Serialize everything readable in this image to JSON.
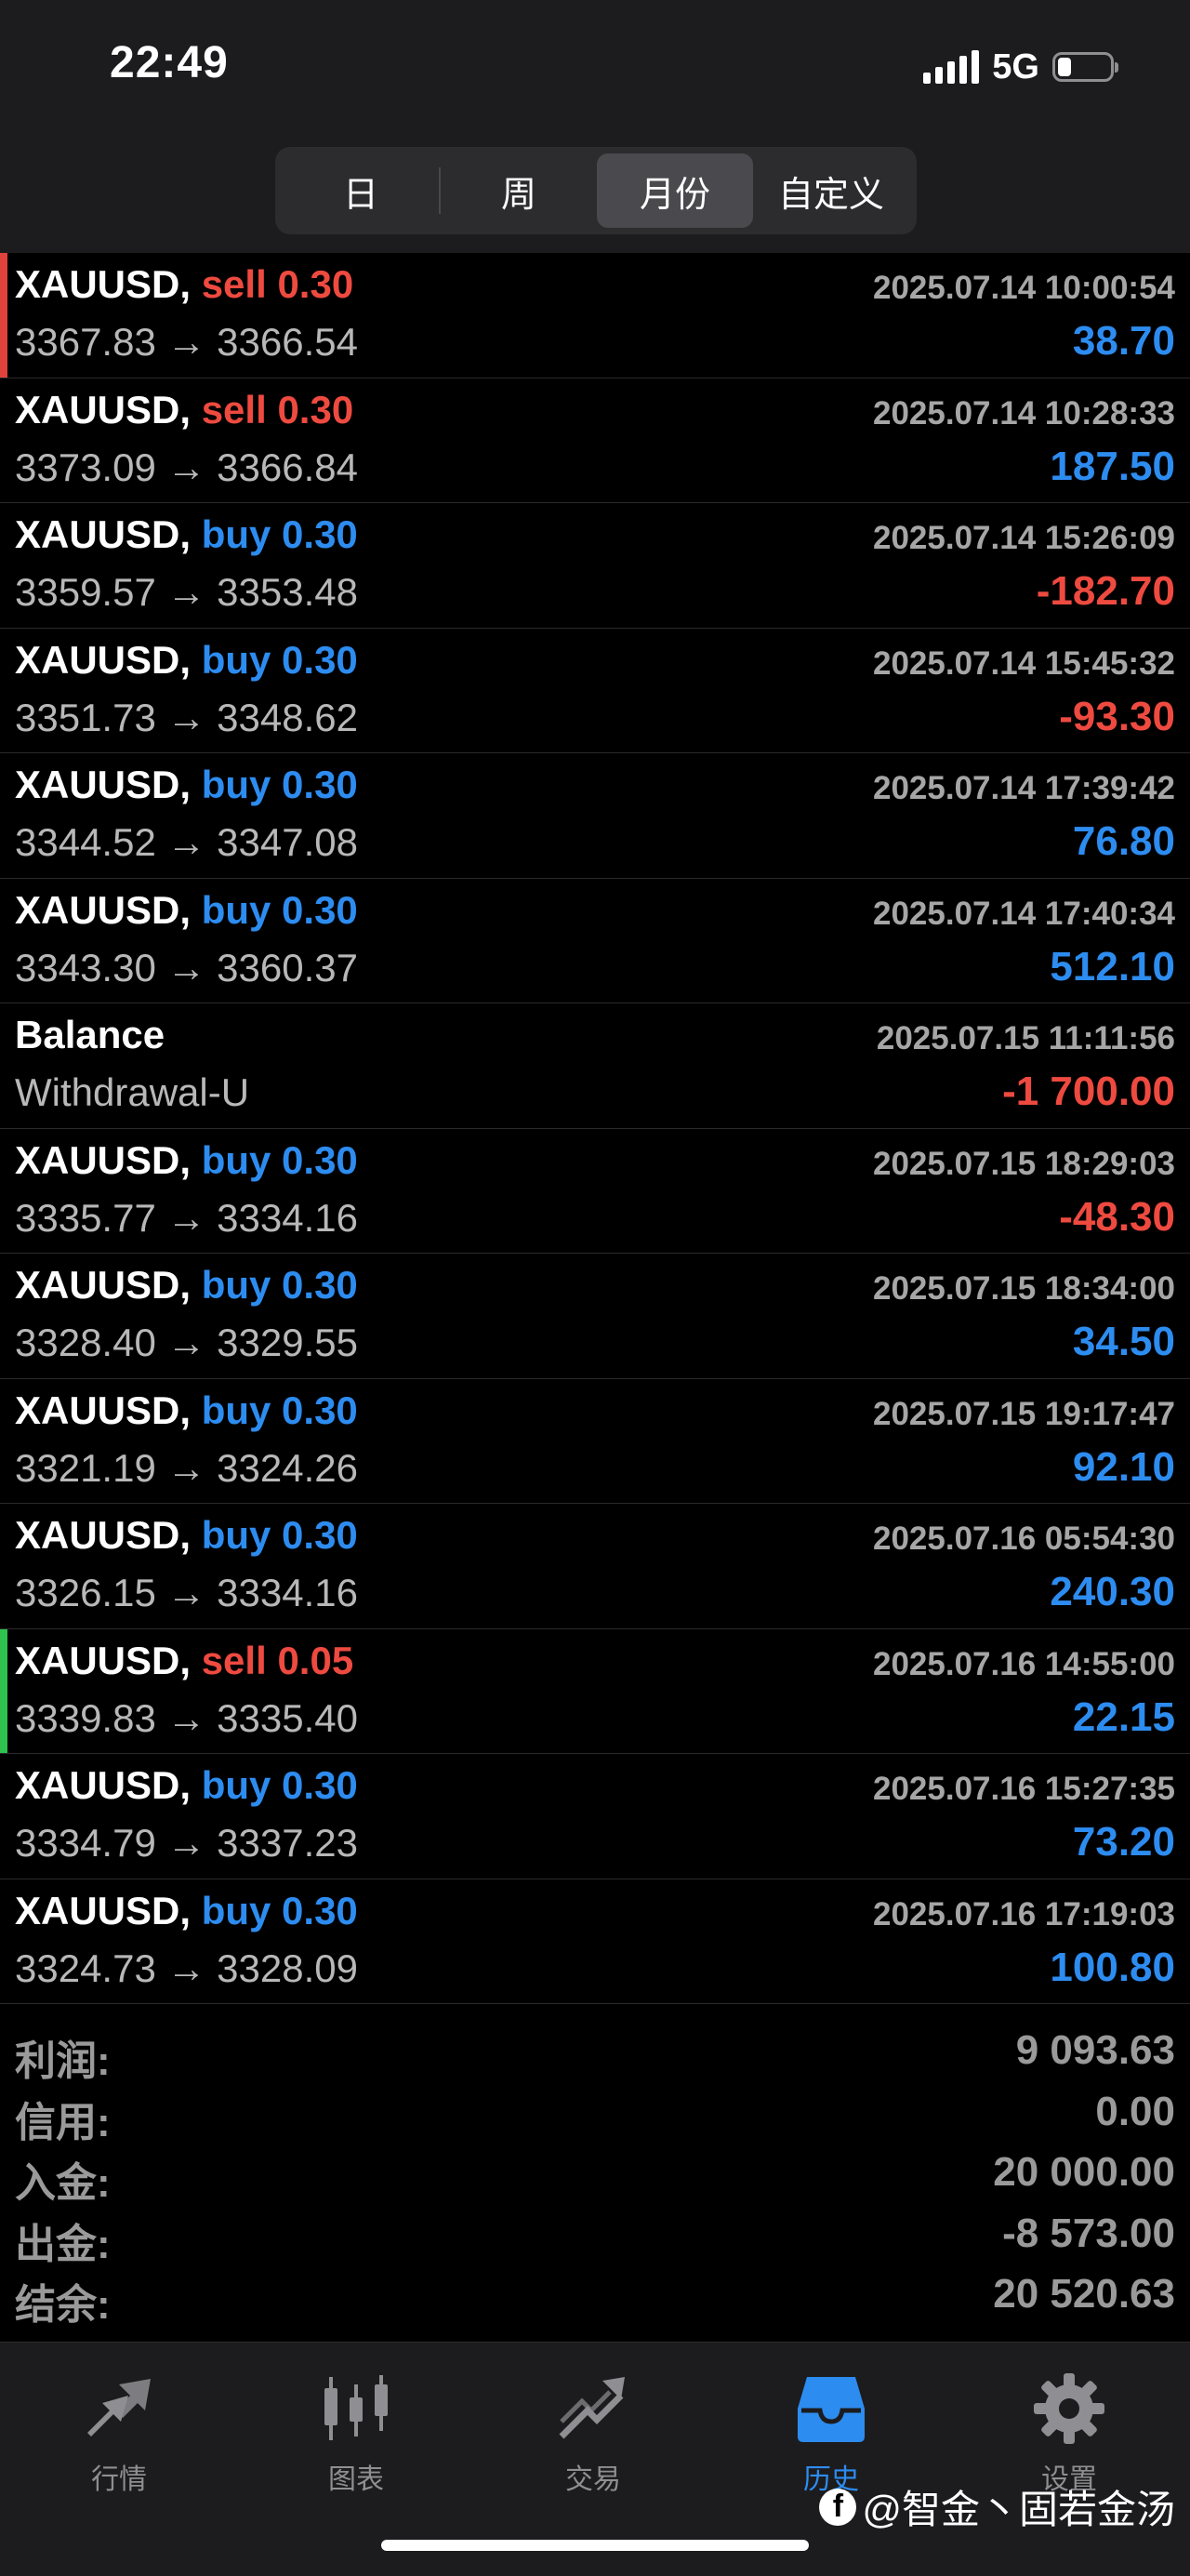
{
  "status_bar": {
    "time": "22:49",
    "network": "5G",
    "battery_level": 0.25
  },
  "period_tabs": [
    {
      "label": "日",
      "active": false
    },
    {
      "label": "周",
      "active": false
    },
    {
      "label": "月份",
      "active": true
    },
    {
      "label": "自定义",
      "active": false
    }
  ],
  "deals": [
    {
      "symbol": "XAUUSD,",
      "side": "sell",
      "volume": "0.30",
      "timestamp": "2025.07.14 10:00:54",
      "prices": "3367.83 → 3366.54",
      "profit": "38.70",
      "marker": "red"
    },
    {
      "symbol": "XAUUSD,",
      "side": "sell",
      "volume": "0.30",
      "timestamp": "2025.07.14 10:28:33",
      "prices": "3373.09 → 3366.84",
      "profit": "187.50"
    },
    {
      "symbol": "XAUUSD,",
      "side": "buy",
      "volume": "0.30",
      "timestamp": "2025.07.14 15:26:09",
      "prices": "3359.57 → 3353.48",
      "profit": "-182.70"
    },
    {
      "symbol": "XAUUSD,",
      "side": "buy",
      "volume": "0.30",
      "timestamp": "2025.07.14 15:45:32",
      "prices": "3351.73 → 3348.62",
      "profit": "-93.30"
    },
    {
      "symbol": "XAUUSD,",
      "side": "buy",
      "volume": "0.30",
      "timestamp": "2025.07.14 17:39:42",
      "prices": "3344.52 → 3347.08",
      "profit": "76.80"
    },
    {
      "symbol": "XAUUSD,",
      "side": "buy",
      "volume": "0.30",
      "timestamp": "2025.07.14 17:40:34",
      "prices": "3343.30 → 3360.37",
      "profit": "512.10"
    },
    {
      "symbol": "Balance",
      "side": "",
      "volume": "",
      "timestamp": "2025.07.15 11:11:56",
      "prices": "Withdrawal-U",
      "profit": "-1 700.00"
    },
    {
      "symbol": "XAUUSD,",
      "side": "buy",
      "volume": "0.30",
      "timestamp": "2025.07.15 18:29:03",
      "prices": "3335.77 → 3334.16",
      "profit": "-48.30"
    },
    {
      "symbol": "XAUUSD,",
      "side": "buy",
      "volume": "0.30",
      "timestamp": "2025.07.15 18:34:00",
      "prices": "3328.40 → 3329.55",
      "profit": "34.50"
    },
    {
      "symbol": "XAUUSD,",
      "side": "buy",
      "volume": "0.30",
      "timestamp": "2025.07.15 19:17:47",
      "prices": "3321.19 → 3324.26",
      "profit": "92.10"
    },
    {
      "symbol": "XAUUSD,",
      "side": "buy",
      "volume": "0.30",
      "timestamp": "2025.07.16 05:54:30",
      "prices": "3326.15 → 3334.16",
      "profit": "240.30"
    },
    {
      "symbol": "XAUUSD,",
      "side": "sell",
      "volume": "0.05",
      "timestamp": "2025.07.16 14:55:00",
      "prices": "3339.83 → 3335.40",
      "profit": "22.15",
      "marker": "green"
    },
    {
      "symbol": "XAUUSD,",
      "side": "buy",
      "volume": "0.30",
      "timestamp": "2025.07.16 15:27:35",
      "prices": "3334.79 → 3337.23",
      "profit": "73.20"
    },
    {
      "symbol": "XAUUSD,",
      "side": "buy",
      "volume": "0.30",
      "timestamp": "2025.07.16 17:19:03",
      "prices": "3324.73 → 3328.09",
      "profit": "100.80"
    }
  ],
  "summary": [
    {
      "label": "利润:",
      "value": "9 093.63"
    },
    {
      "label": "信用:",
      "value": "0.00"
    },
    {
      "label": "入金:",
      "value": "20 000.00"
    },
    {
      "label": "出金:",
      "value": "-8 573.00"
    },
    {
      "label": "结余:",
      "value": "20 520.63"
    }
  ],
  "tabbar": [
    {
      "label": "行情",
      "icon": "quotes-arrows-icon",
      "active": false
    },
    {
      "label": "图表",
      "icon": "candlestick-chart-icon",
      "active": false
    },
    {
      "label": "交易",
      "icon": "trade-trend-icon",
      "active": false
    },
    {
      "label": "历史",
      "icon": "history-inbox-icon",
      "active": true
    },
    {
      "label": "设置",
      "icon": "gear-icon",
      "active": false
    }
  ],
  "watermark": {
    "text": "@智金丶固若金汤",
    "icon": "facebook-icon"
  },
  "colors": {
    "sell": "#ee4a40",
    "buy": "#2d8cf0",
    "negative": "#ee4a40",
    "positive": "#2d8cf0",
    "background": "#000000",
    "header": "#1c1c1e"
  }
}
